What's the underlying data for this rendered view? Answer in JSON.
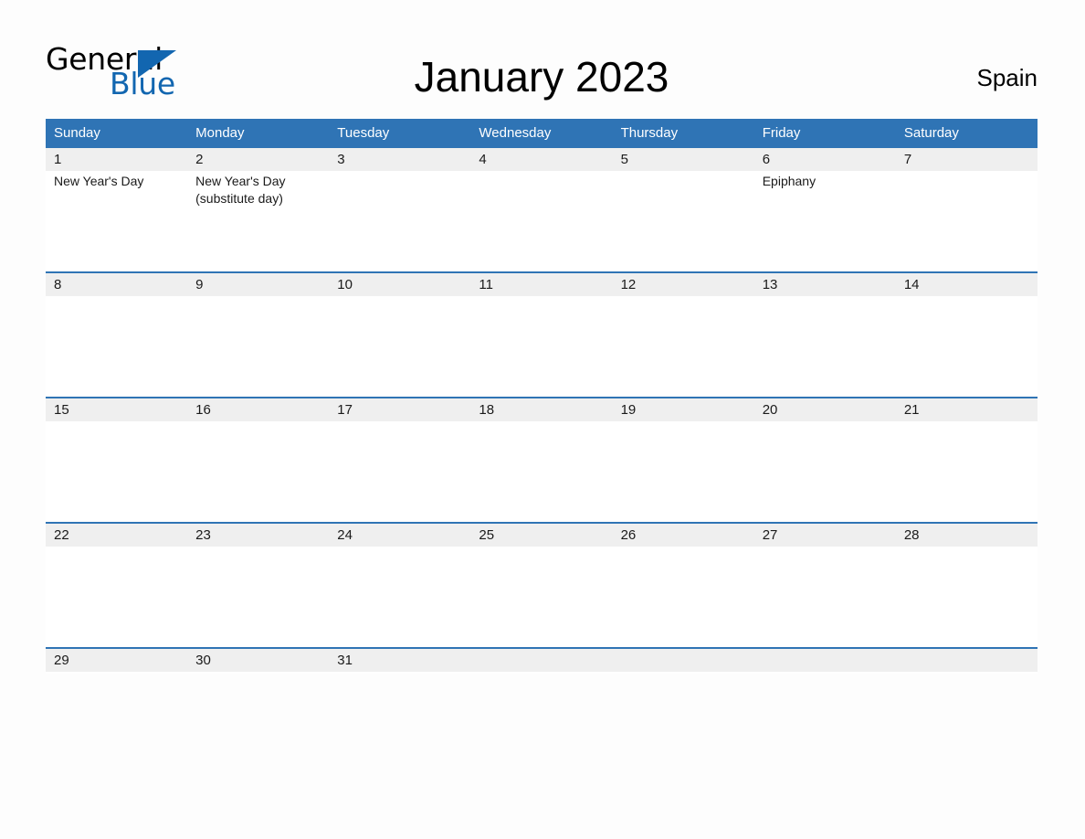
{
  "brand": {
    "name_part1": "General",
    "name_part2": "Blue",
    "triangle_icon": "triangle-icon",
    "accent_color": "#1266b0"
  },
  "header": {
    "title": "January 2023",
    "country": "Spain"
  },
  "colors": {
    "header_blue": "#2f74b5",
    "date_strip_gray": "#efefef",
    "page_background": "#fdfdfd",
    "text": "#1a1a1a"
  },
  "calendar": {
    "weekday_headers": [
      "Sunday",
      "Monday",
      "Tuesday",
      "Wednesday",
      "Thursday",
      "Friday",
      "Saturday"
    ],
    "weeks": [
      {
        "days": [
          {
            "date": "1",
            "events": [
              "New Year's Day"
            ]
          },
          {
            "date": "2",
            "events": [
              "New Year's Day (substitute day)"
            ]
          },
          {
            "date": "3",
            "events": []
          },
          {
            "date": "4",
            "events": []
          },
          {
            "date": "5",
            "events": []
          },
          {
            "date": "6",
            "events": [
              "Epiphany"
            ]
          },
          {
            "date": "7",
            "events": []
          }
        ]
      },
      {
        "days": [
          {
            "date": "8",
            "events": []
          },
          {
            "date": "9",
            "events": []
          },
          {
            "date": "10",
            "events": []
          },
          {
            "date": "11",
            "events": []
          },
          {
            "date": "12",
            "events": []
          },
          {
            "date": "13",
            "events": []
          },
          {
            "date": "14",
            "events": []
          }
        ]
      },
      {
        "days": [
          {
            "date": "15",
            "events": []
          },
          {
            "date": "16",
            "events": []
          },
          {
            "date": "17",
            "events": []
          },
          {
            "date": "18",
            "events": []
          },
          {
            "date": "19",
            "events": []
          },
          {
            "date": "20",
            "events": []
          },
          {
            "date": "21",
            "events": []
          }
        ]
      },
      {
        "days": [
          {
            "date": "22",
            "events": []
          },
          {
            "date": "23",
            "events": []
          },
          {
            "date": "24",
            "events": []
          },
          {
            "date": "25",
            "events": []
          },
          {
            "date": "26",
            "events": []
          },
          {
            "date": "27",
            "events": []
          },
          {
            "date": "28",
            "events": []
          }
        ]
      },
      {
        "days": [
          {
            "date": "29",
            "events": []
          },
          {
            "date": "30",
            "events": []
          },
          {
            "date": "31",
            "events": []
          },
          {
            "date": "",
            "events": []
          },
          {
            "date": "",
            "events": []
          },
          {
            "date": "",
            "events": []
          },
          {
            "date": "",
            "events": []
          }
        ]
      }
    ]
  }
}
